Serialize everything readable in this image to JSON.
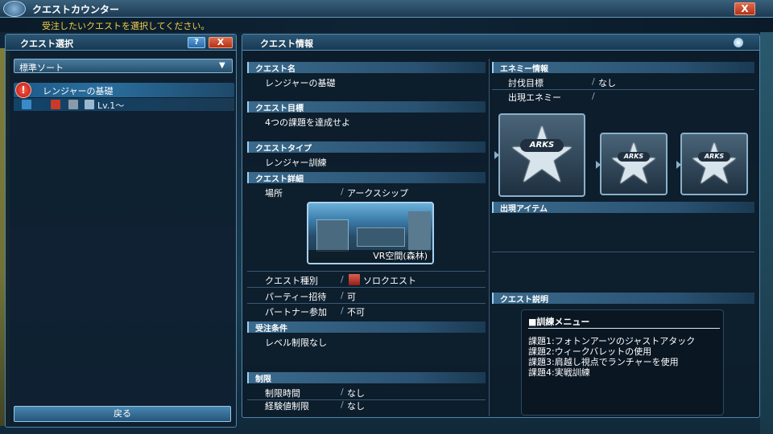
{
  "window": {
    "title": "クエストカウンター",
    "close_label": "X",
    "instruction": "受注したいクエストを選択してください。"
  },
  "left_panel": {
    "title": "クエスト選択",
    "help_label": "?",
    "close_label": "X",
    "sort": {
      "selected": "標準ソート",
      "arrow": "▼"
    },
    "quests": [
      {
        "alert": "!",
        "name": "レンジャーの基礎",
        "level": "Lv.1〜"
      }
    ],
    "back_label": "戻る"
  },
  "right_panel": {
    "title": "クエスト情報",
    "sections": {
      "quest_name": {
        "header": "クエスト名",
        "value": "レンジャーの基礎"
      },
      "quest_goal": {
        "header": "クエスト目標",
        "value": "4つの課題を達成せよ"
      },
      "quest_type": {
        "header": "クエストタイプ",
        "value": "レンジャー訓練"
      },
      "quest_detail": {
        "header": "クエスト詳細",
        "location_key": "場所",
        "location_value": "アークスシップ",
        "location_image_label": "VR空間(森林)",
        "category_key": "クエスト種別",
        "category_value": "ソロクエスト",
        "party_key": "パーティー招待",
        "party_value": "可",
        "partner_key": "パートナー参加",
        "partner_value": "不可"
      },
      "conditions": {
        "header": "受注条件",
        "value": "レベル制限なし"
      },
      "limits": {
        "header": "制限",
        "time_key": "制限時間",
        "time_value": "なし",
        "exp_key": "経験値制限",
        "exp_value": "なし"
      },
      "enemy_info": {
        "header": "エネミー情報",
        "target_key": "討伐目標",
        "target_value": "なし",
        "appear_key": "出現エネミー",
        "badge_text": "ARKS"
      },
      "items": {
        "header": "出現アイテム"
      },
      "explanation": {
        "header": "クエスト説明",
        "title": "■訓練メニュー",
        "lines": [
          "課題1:フォトンアーツのジャストアタック",
          "課題2:ウィークバレットの使用",
          "課題3:肩越し視点でランチャーを使用",
          "課題4:実戦訓練"
        ]
      }
    }
  },
  "slash": "/"
}
